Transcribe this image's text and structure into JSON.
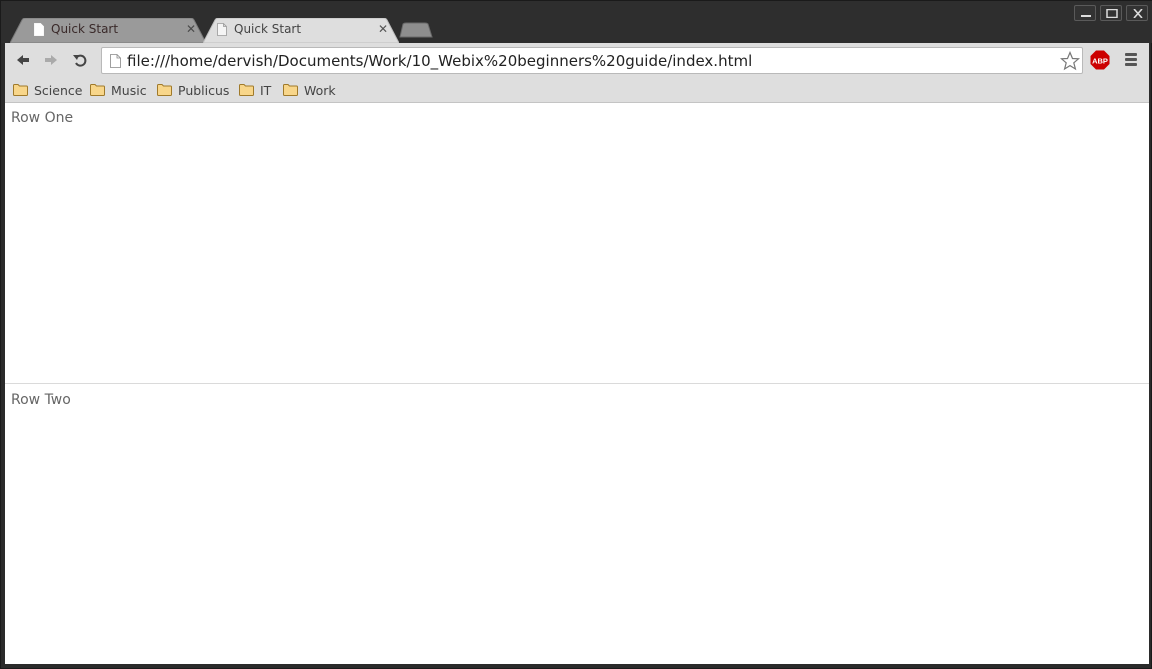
{
  "window": {
    "controls": [
      "minimize",
      "maximize",
      "close"
    ]
  },
  "tabs": [
    {
      "title": "Quick Start",
      "active": false
    },
    {
      "title": "Quick Start",
      "active": true
    }
  ],
  "toolbar": {
    "url": "file:///home/dervish/Documents/Work/10_Webix%20beginners%20guide/index.html",
    "extension_label": "ABP"
  },
  "bookmarks": [
    {
      "label": "Science"
    },
    {
      "label": "Music"
    },
    {
      "label": "Publicus"
    },
    {
      "label": "IT"
    },
    {
      "label": "Work"
    }
  ],
  "page": {
    "rows": [
      {
        "label": "Row One"
      },
      {
        "label": "Row Two"
      }
    ]
  },
  "colors": {
    "abp_red": "#cc0000",
    "folder_fill": "#f8d68a",
    "folder_stroke": "#a07a2a"
  }
}
